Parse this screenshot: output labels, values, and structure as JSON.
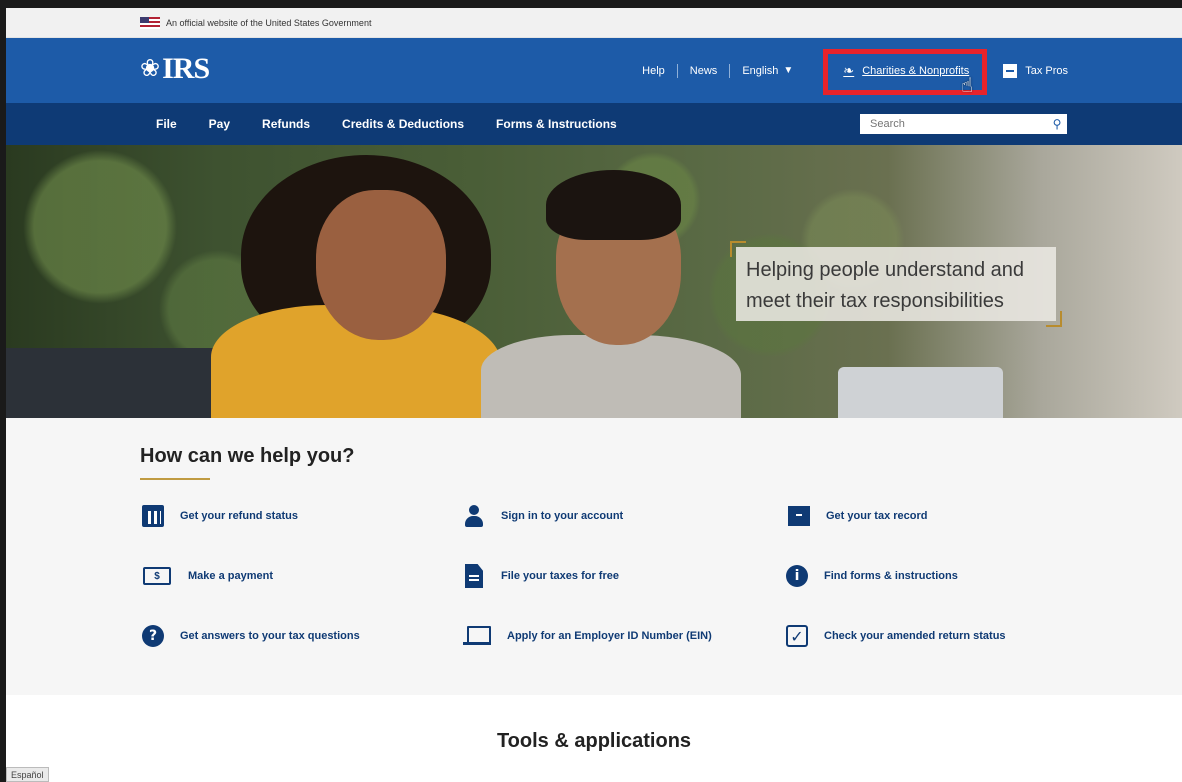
{
  "gov_banner": {
    "text": "An official website of the United States Government"
  },
  "header": {
    "logo_text": "IRS",
    "util_links": {
      "help": "Help",
      "news": "News",
      "language": "English",
      "charities": "Charities & Nonprofits",
      "tax_pros": "Tax Pros"
    }
  },
  "main_nav": {
    "items": [
      "File",
      "Pay",
      "Refunds",
      "Credits & Deductions",
      "Forms & Instructions"
    ],
    "search_placeholder": "Search"
  },
  "hero": {
    "tagline_line1": "Helping people understand and",
    "tagline_line2": "meet their tax responsibilities"
  },
  "help": {
    "title": "How can we help you?",
    "items": [
      {
        "label": "Get your refund status",
        "icon": "calendar-icon"
      },
      {
        "label": "Sign in to your account",
        "icon": "user-icon"
      },
      {
        "label": "Get your tax record",
        "icon": "archive-icon"
      },
      {
        "label": "Make a payment",
        "icon": "cash-icon"
      },
      {
        "label": "File your taxes for free",
        "icon": "document-icon"
      },
      {
        "label": "Find forms & instructions",
        "icon": "info-icon"
      },
      {
        "label": "Get answers to your tax questions",
        "icon": "question-icon"
      },
      {
        "label": "Apply for an Employer ID Number (EIN)",
        "icon": "laptop-icon"
      },
      {
        "label": "Check your amended return status",
        "icon": "checkbox-icon"
      }
    ]
  },
  "tools": {
    "title": "Tools & applications"
  },
  "status_bar": {
    "text": "Español"
  },
  "colors": {
    "header_blue": "#1d5ba8",
    "nav_navy": "#0e3a75",
    "link_navy": "#0f3a74",
    "highlight_red": "#e8232b",
    "accent_gold": "#c09b41"
  }
}
